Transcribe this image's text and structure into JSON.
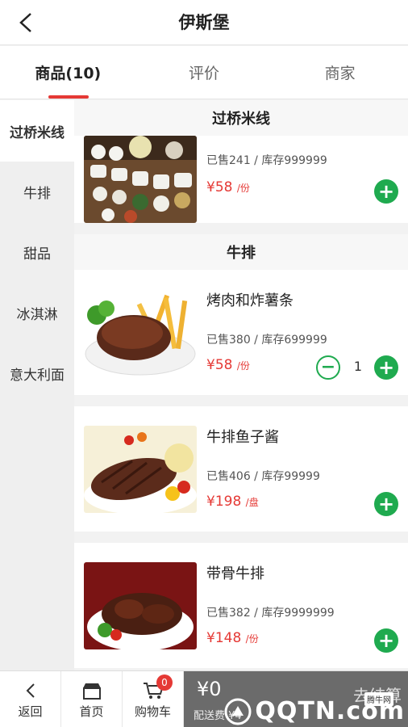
{
  "header": {
    "title": "伊斯堡"
  },
  "tabs": [
    {
      "label": "商品(10)",
      "active": true
    },
    {
      "label": "评价",
      "active": false
    },
    {
      "label": "商家",
      "active": false
    }
  ],
  "sidebar": {
    "categories": [
      {
        "label": "过桥米线",
        "active": true
      },
      {
        "label": "牛排",
        "active": false
      },
      {
        "label": "甜品",
        "active": false
      },
      {
        "label": "冰淇淋",
        "active": false
      },
      {
        "label": "意大利面",
        "active": false
      }
    ]
  },
  "sections": [
    {
      "title": "过桥米线",
      "items": [
        {
          "name": "",
          "sales": "已售241 / 库存999999",
          "price": "¥58",
          "unit": "/份",
          "image": "rice-noodle-platter"
        }
      ]
    },
    {
      "title": "牛排",
      "items": [
        {
          "name": "烤肉和炸薯条",
          "sales": "已售380 / 库存699999",
          "price": "¥58",
          "unit": "/份",
          "quantity": "1",
          "image": "steak-and-fries"
        },
        {
          "name": "牛排鱼子酱",
          "sales": "已售406 / 库存99999",
          "price": "¥198",
          "unit": "/盘",
          "image": "steak-caviar"
        },
        {
          "name": "带骨牛排",
          "sales": "已售382 / 库存9999999",
          "price": "¥148",
          "unit": "/份",
          "image": "bone-steak"
        }
      ]
    }
  ],
  "bottom_bar": {
    "back_label": "返回",
    "home_label": "首页",
    "cart_label": "购物车",
    "cart_badge": "0",
    "total": "¥0",
    "delivery": "配送费 ¥4",
    "checkout_label": "去结算"
  },
  "watermark": {
    "text": "QQTN.com",
    "tag": "腾牛网"
  },
  "colors": {
    "accent": "#e53935",
    "add_button": "#1faa4f",
    "checkout_bg": "#6b6b6b"
  }
}
